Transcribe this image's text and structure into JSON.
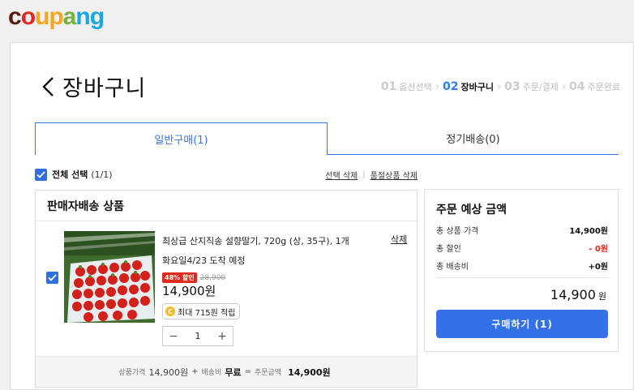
{
  "brand": {
    "logo_letters": [
      "c",
      "o",
      "u",
      "p",
      "a",
      "n",
      "g"
    ],
    "logo_colors": [
      "#5b1a12",
      "#e2281e",
      "#f5a623",
      "#f5a623",
      "#76b33e",
      "#1ba6e4",
      "#1ba6e4"
    ]
  },
  "header": {
    "title": "장바구니",
    "steps": [
      {
        "num": "01",
        "label": "옵션선택"
      },
      {
        "num": "02",
        "label": "장바구니"
      },
      {
        "num": "03",
        "label": "주문/결제"
      },
      {
        "num": "04",
        "label": "주문완료"
      }
    ]
  },
  "tabs": [
    {
      "label": "일반구매(1)"
    },
    {
      "label": "정기배송(0)"
    }
  ],
  "select_all": {
    "label": "전체 선택",
    "count": "(1/1)",
    "delete_selected": "선택 삭제",
    "delete_soldout": "품절상품 삭제"
  },
  "seller": {
    "heading": "판매자배송 상품",
    "item": {
      "name": "최상급 산지직송 설향딸기, 720g (상, 35구), 1개",
      "delete_label": "삭제",
      "arrival": "화요일4/23 도착 예정",
      "discount": "48% 할인",
      "original_price": "28,900",
      "price": "14,900원",
      "reward_coin": "C",
      "reward": "최대 715원 적립",
      "quantity": "1",
      "minus": "−",
      "plus": "+"
    },
    "summary": {
      "product_price_label": "상품가격",
      "product_price": "14,900원",
      "plus": "+",
      "shipping_label": "배송비",
      "shipping": "무료",
      "equals": "=",
      "order_amount_label": "주문금액",
      "order_amount": "14,900원"
    }
  },
  "order": {
    "title": "주문 예상 금액",
    "lines": [
      {
        "label": "총 상품 가격",
        "value": "14,900원"
      },
      {
        "label": "총 할인",
        "value": "- 0원"
      },
      {
        "label": "총 배송비",
        "value": "+0원"
      }
    ],
    "total": "14,900",
    "total_unit": "원",
    "buy_button": "구매하기 (1)"
  },
  "colors": {
    "accent": "#3470e8",
    "discount": "#e0281b",
    "reward": "#f3b921"
  }
}
